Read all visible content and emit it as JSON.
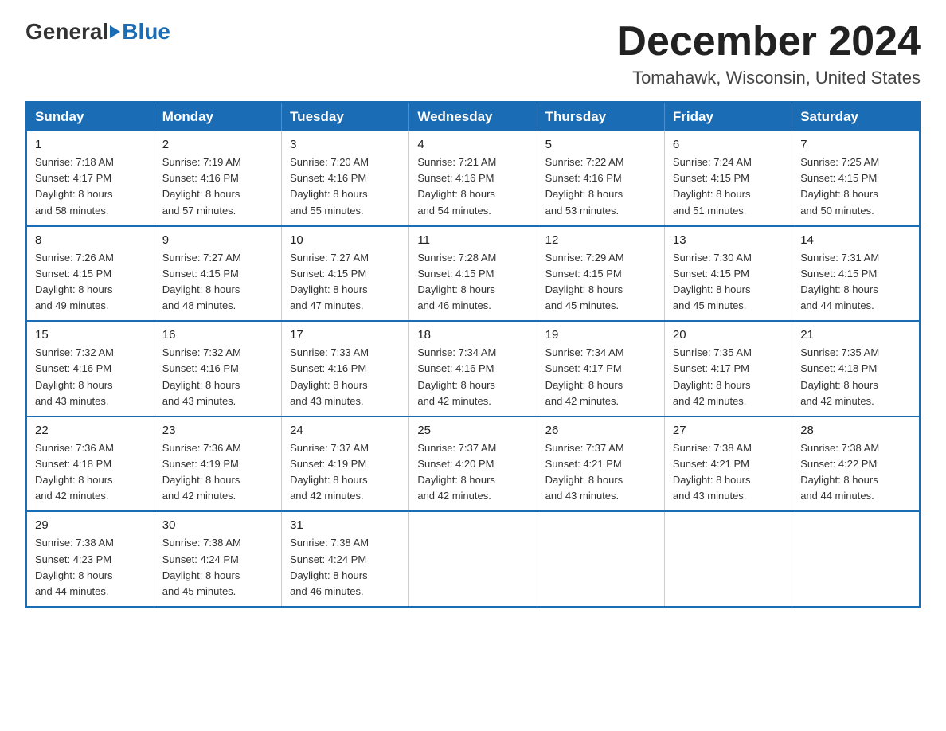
{
  "logo": {
    "general": "General",
    "triangle": "",
    "blue": "Blue",
    "subtitle": "Blue"
  },
  "header": {
    "month_title": "December 2024",
    "location": "Tomahawk, Wisconsin, United States"
  },
  "weekdays": [
    "Sunday",
    "Monday",
    "Tuesday",
    "Wednesday",
    "Thursday",
    "Friday",
    "Saturday"
  ],
  "weeks": [
    [
      {
        "day": "1",
        "sunrise": "Sunrise: 7:18 AM",
        "sunset": "Sunset: 4:17 PM",
        "daylight": "Daylight: 8 hours and 58 minutes."
      },
      {
        "day": "2",
        "sunrise": "Sunrise: 7:19 AM",
        "sunset": "Sunset: 4:16 PM",
        "daylight": "Daylight: 8 hours and 57 minutes."
      },
      {
        "day": "3",
        "sunrise": "Sunrise: 7:20 AM",
        "sunset": "Sunset: 4:16 PM",
        "daylight": "Daylight: 8 hours and 55 minutes."
      },
      {
        "day": "4",
        "sunrise": "Sunrise: 7:21 AM",
        "sunset": "Sunset: 4:16 PM",
        "daylight": "Daylight: 8 hours and 54 minutes."
      },
      {
        "day": "5",
        "sunrise": "Sunrise: 7:22 AM",
        "sunset": "Sunset: 4:16 PM",
        "daylight": "Daylight: 8 hours and 53 minutes."
      },
      {
        "day": "6",
        "sunrise": "Sunrise: 7:24 AM",
        "sunset": "Sunset: 4:15 PM",
        "daylight": "Daylight: 8 hours and 51 minutes."
      },
      {
        "day": "7",
        "sunrise": "Sunrise: 7:25 AM",
        "sunset": "Sunset: 4:15 PM",
        "daylight": "Daylight: 8 hours and 50 minutes."
      }
    ],
    [
      {
        "day": "8",
        "sunrise": "Sunrise: 7:26 AM",
        "sunset": "Sunset: 4:15 PM",
        "daylight": "Daylight: 8 hours and 49 minutes."
      },
      {
        "day": "9",
        "sunrise": "Sunrise: 7:27 AM",
        "sunset": "Sunset: 4:15 PM",
        "daylight": "Daylight: 8 hours and 48 minutes."
      },
      {
        "day": "10",
        "sunrise": "Sunrise: 7:27 AM",
        "sunset": "Sunset: 4:15 PM",
        "daylight": "Daylight: 8 hours and 47 minutes."
      },
      {
        "day": "11",
        "sunrise": "Sunrise: 7:28 AM",
        "sunset": "Sunset: 4:15 PM",
        "daylight": "Daylight: 8 hours and 46 minutes."
      },
      {
        "day": "12",
        "sunrise": "Sunrise: 7:29 AM",
        "sunset": "Sunset: 4:15 PM",
        "daylight": "Daylight: 8 hours and 45 minutes."
      },
      {
        "day": "13",
        "sunrise": "Sunrise: 7:30 AM",
        "sunset": "Sunset: 4:15 PM",
        "daylight": "Daylight: 8 hours and 45 minutes."
      },
      {
        "day": "14",
        "sunrise": "Sunrise: 7:31 AM",
        "sunset": "Sunset: 4:15 PM",
        "daylight": "Daylight: 8 hours and 44 minutes."
      }
    ],
    [
      {
        "day": "15",
        "sunrise": "Sunrise: 7:32 AM",
        "sunset": "Sunset: 4:16 PM",
        "daylight": "Daylight: 8 hours and 43 minutes."
      },
      {
        "day": "16",
        "sunrise": "Sunrise: 7:32 AM",
        "sunset": "Sunset: 4:16 PM",
        "daylight": "Daylight: 8 hours and 43 minutes."
      },
      {
        "day": "17",
        "sunrise": "Sunrise: 7:33 AM",
        "sunset": "Sunset: 4:16 PM",
        "daylight": "Daylight: 8 hours and 43 minutes."
      },
      {
        "day": "18",
        "sunrise": "Sunrise: 7:34 AM",
        "sunset": "Sunset: 4:16 PM",
        "daylight": "Daylight: 8 hours and 42 minutes."
      },
      {
        "day": "19",
        "sunrise": "Sunrise: 7:34 AM",
        "sunset": "Sunset: 4:17 PM",
        "daylight": "Daylight: 8 hours and 42 minutes."
      },
      {
        "day": "20",
        "sunrise": "Sunrise: 7:35 AM",
        "sunset": "Sunset: 4:17 PM",
        "daylight": "Daylight: 8 hours and 42 minutes."
      },
      {
        "day": "21",
        "sunrise": "Sunrise: 7:35 AM",
        "sunset": "Sunset: 4:18 PM",
        "daylight": "Daylight: 8 hours and 42 minutes."
      }
    ],
    [
      {
        "day": "22",
        "sunrise": "Sunrise: 7:36 AM",
        "sunset": "Sunset: 4:18 PM",
        "daylight": "Daylight: 8 hours and 42 minutes."
      },
      {
        "day": "23",
        "sunrise": "Sunrise: 7:36 AM",
        "sunset": "Sunset: 4:19 PM",
        "daylight": "Daylight: 8 hours and 42 minutes."
      },
      {
        "day": "24",
        "sunrise": "Sunrise: 7:37 AM",
        "sunset": "Sunset: 4:19 PM",
        "daylight": "Daylight: 8 hours and 42 minutes."
      },
      {
        "day": "25",
        "sunrise": "Sunrise: 7:37 AM",
        "sunset": "Sunset: 4:20 PM",
        "daylight": "Daylight: 8 hours and 42 minutes."
      },
      {
        "day": "26",
        "sunrise": "Sunrise: 7:37 AM",
        "sunset": "Sunset: 4:21 PM",
        "daylight": "Daylight: 8 hours and 43 minutes."
      },
      {
        "day": "27",
        "sunrise": "Sunrise: 7:38 AM",
        "sunset": "Sunset: 4:21 PM",
        "daylight": "Daylight: 8 hours and 43 minutes."
      },
      {
        "day": "28",
        "sunrise": "Sunrise: 7:38 AM",
        "sunset": "Sunset: 4:22 PM",
        "daylight": "Daylight: 8 hours and 44 minutes."
      }
    ],
    [
      {
        "day": "29",
        "sunrise": "Sunrise: 7:38 AM",
        "sunset": "Sunset: 4:23 PM",
        "daylight": "Daylight: 8 hours and 44 minutes."
      },
      {
        "day": "30",
        "sunrise": "Sunrise: 7:38 AM",
        "sunset": "Sunset: 4:24 PM",
        "daylight": "Daylight: 8 hours and 45 minutes."
      },
      {
        "day": "31",
        "sunrise": "Sunrise: 7:38 AM",
        "sunset": "Sunset: 4:24 PM",
        "daylight": "Daylight: 8 hours and 46 minutes."
      },
      null,
      null,
      null,
      null
    ]
  ]
}
